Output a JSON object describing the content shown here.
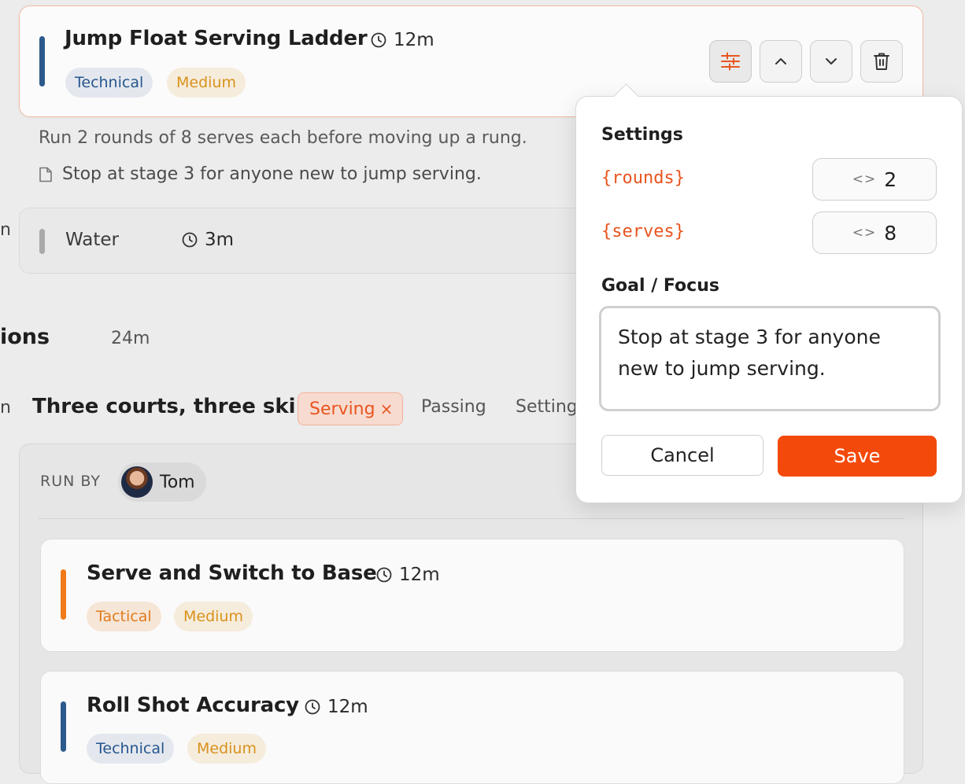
{
  "drill_top": {
    "title": "Jump Float Serving Ladder",
    "duration": "12m",
    "tags": [
      "Technical",
      "Medium"
    ],
    "description": "Run 2 rounds of 8 serves each before moving up a rung.",
    "note": "Stop at stage 3 for anyone new to jump serving.",
    "accent_color": "#2c5a8c"
  },
  "water": {
    "label": "Water",
    "duration": "3m",
    "left_cut": "n"
  },
  "section": {
    "title_fragment": "ions",
    "duration": "24m"
  },
  "station": {
    "left_cut": "n",
    "title": "Three courts, three ski",
    "filter_tags": [
      "Serving",
      "Passing",
      "Setting"
    ],
    "remove_glyph": "×",
    "run_by_label": "RUN BY",
    "run_by_name": "Tom"
  },
  "drills": [
    {
      "title": "Serve and Switch to Base",
      "duration": "12m",
      "tags": [
        "Tactical",
        "Medium"
      ],
      "accent_color": "#f07b1a"
    },
    {
      "title": "Roll Shot Accuracy",
      "duration": "12m",
      "tags": [
        "Technical",
        "Medium"
      ],
      "accent_color": "#2c5a8c"
    }
  ],
  "popover": {
    "settings_heading": "Settings",
    "params": [
      {
        "name": "{rounds}",
        "value": "2"
      },
      {
        "name": "{serves}",
        "value": "8"
      }
    ],
    "stepper_glyph": "<>",
    "goal_heading": "Goal / Focus",
    "goal_text": "Stop at stage 3 for anyone new to jump serving.",
    "cancel_label": "Cancel",
    "save_label": "Save",
    "save_color": "#f34a0b"
  },
  "icons": [
    "settings-sliders-icon",
    "chevron-up-icon",
    "chevron-down-icon",
    "trash-icon",
    "clock-icon",
    "note-icon",
    "avatar"
  ]
}
